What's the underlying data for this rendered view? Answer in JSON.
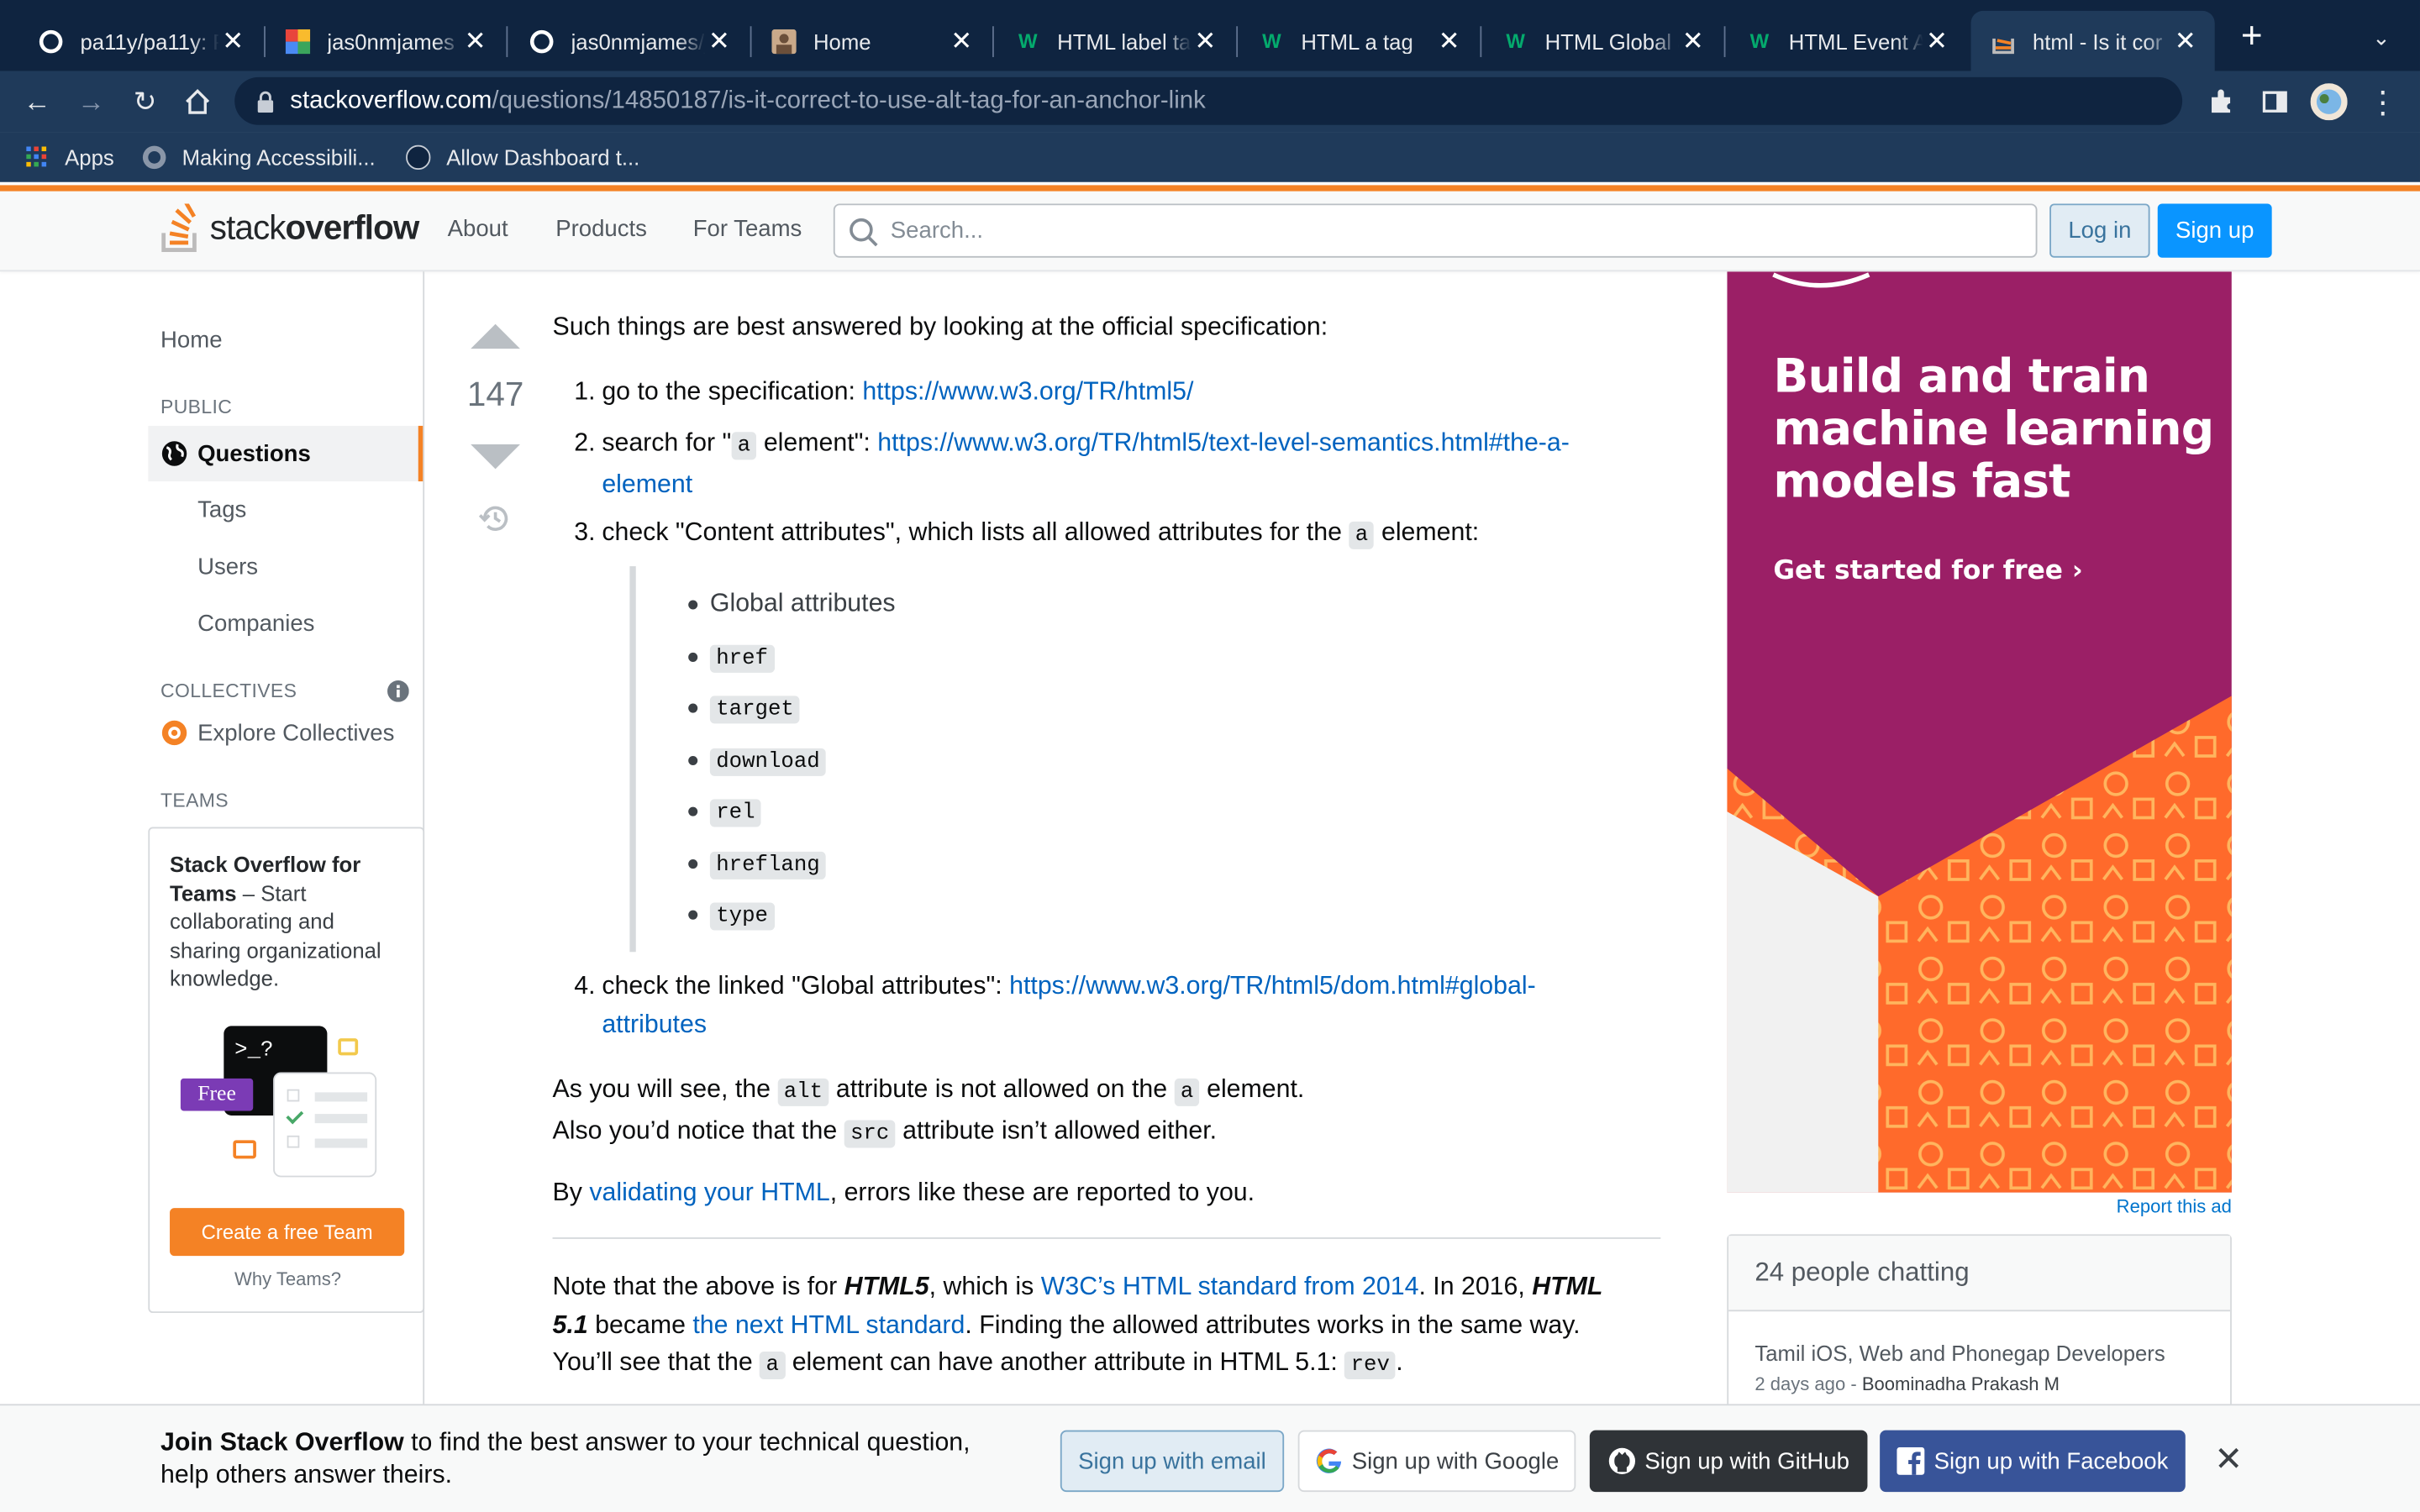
{
  "browser": {
    "tabs": [
      {
        "title": "pa11y/pa11y: P",
        "icon": "github-icon"
      },
      {
        "title": "jas0nmjames /",
        "icon": "app-icon"
      },
      {
        "title": "jas0nmjames/j",
        "icon": "github-icon"
      },
      {
        "title": "Home",
        "icon": "avatar-icon"
      },
      {
        "title": "HTML label ta",
        "icon": "w3schools-icon"
      },
      {
        "title": "HTML a tag",
        "icon": "w3schools-icon"
      },
      {
        "title": "HTML Global a",
        "icon": "w3schools-icon"
      },
      {
        "title": "HTML Event A",
        "icon": "w3schools-icon"
      },
      {
        "title": "html - Is it cor",
        "icon": "stackoverflow-icon",
        "active": true
      }
    ],
    "url_host": "stackoverflow.com",
    "url_path": "/questions/14850187/is-it-correct-to-use-alt-tag-for-an-anchor-link",
    "bookmarks": [
      "Apps",
      "Making Accessibili...",
      "Allow Dashboard t..."
    ]
  },
  "header": {
    "logo_regular": "stack",
    "logo_bold": "overflow",
    "nav": [
      "About",
      "Products",
      "For Teams"
    ],
    "search_placeholder": "Search...",
    "login": "Log in",
    "signup": "Sign up"
  },
  "sidebar": {
    "home": "Home",
    "public_heading": "PUBLIC",
    "questions": "Questions",
    "tags": "Tags",
    "users": "Users",
    "companies": "Companies",
    "collectives_heading": "COLLECTIVES",
    "explore_collectives": "Explore Collectives",
    "teams_heading": "TEAMS",
    "teams_title": "Stack Overflow for Teams",
    "teams_body": "– Start collaborating and sharing organizational knowledge.",
    "free_badge": "Free",
    "terminal_prompt": ">_?",
    "create_team": "Create a free Team",
    "why_teams": "Why Teams?"
  },
  "answer": {
    "votes": "147",
    "intro": "Such things are best answered by looking at the official specification:",
    "step1_text": "go to the specification:",
    "step1_link": "https://www.w3.org/TR/html5/",
    "step2_text_a": "search for \"",
    "step2_code": "a",
    "step2_text_b": " element\":",
    "step2_link_a": "https://www.w3.org/TR/html5/text-level-semantics.html#the-a-",
    "step2_link_b": "element",
    "step3_text_a": "check \"Content attributes\", which lists all allowed attributes for the",
    "step3_code": "a",
    "step3_text_b": "element:",
    "attributes_label": "Global attributes",
    "attributes": [
      "href",
      "target",
      "download",
      "rel",
      "hreflang",
      "type"
    ],
    "step4_text": "check the linked \"Global attributes\":",
    "step4_link_a": "https://www.w3.org/TR/html5/dom.html#global-",
    "step4_link_b": "attributes",
    "p1_a": "As you will see, the",
    "p1_code1": "alt",
    "p1_b": "attribute is not allowed on the",
    "p1_code2": "a",
    "p1_c": "element.",
    "p1_d": "Also you’d notice that the",
    "p1_code3": "src",
    "p1_e": "attribute isn’t allowed either.",
    "p2_a": "By",
    "p2_link": "validating your HTML",
    "p2_b": ", errors like these are reported to you.",
    "p3_a": "Note that the above is for",
    "p3_html5": "HTML5",
    "p3_b": ", which is",
    "p3_link1": "W3C’s HTML standard from 2014",
    "p3_c": ". In 2016,",
    "p3_html51a": "HTML",
    "p3_html51b": "5.1",
    "p3_d": "became",
    "p3_link2": "the next HTML standard",
    "p3_e": ". Finding the allowed attributes works in the same way.",
    "p3_f": "You’ll see that the",
    "p3_code": "a",
    "p3_g": "element can have another attribute in HTML 5.1:",
    "p3_code2": "rev",
    "p3_h": "."
  },
  "ad": {
    "line1": "Build and train",
    "line2": "machine learning",
    "line3": "models fast",
    "cta": "Get started for free ›",
    "report": "Report this ad",
    "colors": {
      "purple": "#9b1f66",
      "orange": "#ff6a2b",
      "white": "#ffffff"
    }
  },
  "chat": {
    "title": "24 people chatting",
    "room": "Tamil iOS, Web and Phonegap Developers",
    "meta_time": "2 days ago",
    "meta_user": "Boominadha Prakash M"
  },
  "banner": {
    "bold": "Join Stack Overflow",
    "text_a": " to find the best answer to your technical question,",
    "text_b": "help others answer theirs.",
    "email": "Sign up with email",
    "google": "Sign up with Google",
    "github": "Sign up with GitHub",
    "facebook": "Sign up with Facebook"
  }
}
